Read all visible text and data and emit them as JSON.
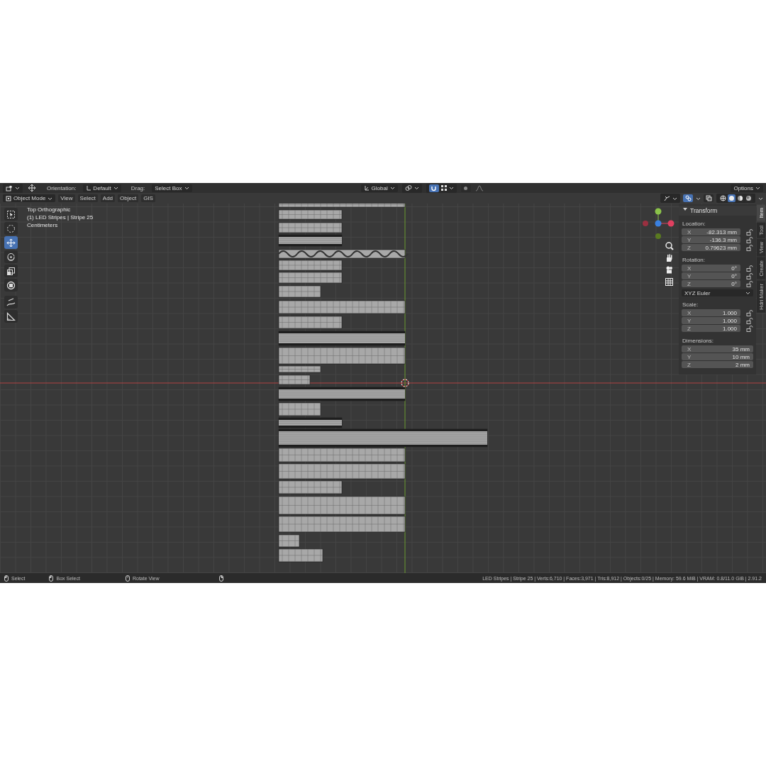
{
  "header": {
    "orientation_label": "Orientation:",
    "orientation": "Default",
    "drag_label": "Drag:",
    "drag": "Select Box",
    "transform_orientation": "Global",
    "snap_on": true,
    "proportional_on": false,
    "options": "Options"
  },
  "menu": {
    "mode": "Object Mode",
    "items": [
      "View",
      "Select",
      "Add",
      "Object",
      "GIS"
    ]
  },
  "view_shading": {
    "overlays_on": true,
    "xray_on": false,
    "modes": [
      {
        "kind": "wireframe",
        "selected": false
      },
      {
        "kind": "solid",
        "selected": true
      },
      {
        "kind": "material",
        "selected": false
      },
      {
        "kind": "rendered",
        "selected": false
      }
    ]
  },
  "viewport": {
    "info": [
      "Top Orthographic",
      "(1) LED Stripes | Stripe 25",
      "Centimeters"
    ]
  },
  "tools": [
    {
      "kind": "select",
      "selected": false
    },
    {
      "kind": "cursor",
      "selected": false
    },
    {
      "kind": "move",
      "selected": true
    },
    {
      "kind": "rotate",
      "selected": false
    },
    {
      "kind": "scale",
      "selected": false
    },
    {
      "kind": "transform",
      "selected": false
    },
    {
      "kind": "annotate",
      "selected": false
    },
    {
      "kind": "measure",
      "selected": false
    }
  ],
  "sidebar": {
    "tabs": [
      {
        "label": "Item",
        "selected": true
      },
      {
        "label": "Tool",
        "selected": false
      },
      {
        "label": "View",
        "selected": false
      },
      {
        "label": "Create",
        "selected": false
      },
      {
        "label": "Hdri Maker",
        "selected": false
      }
    ],
    "panel_title": "Transform",
    "groups": [
      {
        "label": "Location:",
        "locks": true,
        "rows": [
          {
            "axis": "X",
            "value": "-82.313 mm"
          },
          {
            "axis": "Y",
            "value": "-136.3 mm"
          },
          {
            "axis": "Z",
            "value": "0.79623 mm"
          }
        ]
      },
      {
        "label": "Rotation:",
        "locks": true,
        "rows": [
          {
            "axis": "X",
            "value": "0°"
          },
          {
            "axis": "Y",
            "value": "0°"
          },
          {
            "axis": "Z",
            "value": "0°"
          }
        ],
        "mode": "XYZ Euler"
      },
      {
        "label": "Scale:",
        "locks": true,
        "rows": [
          {
            "axis": "X",
            "value": "1.000"
          },
          {
            "axis": "Y",
            "value": "1.000"
          },
          {
            "axis": "Z",
            "value": "1.000"
          }
        ]
      },
      {
        "label": "Dimensions:",
        "locks": false,
        "rows": [
          {
            "axis": "X",
            "value": "35 mm"
          },
          {
            "axis": "Y",
            "value": "10 mm"
          },
          {
            "axis": "Z",
            "value": "2 mm"
          }
        ]
      }
    ]
  },
  "status_bar": {
    "hints": [
      {
        "kind": "left",
        "text": "Select"
      },
      {
        "kind": "drag",
        "text": "Box Select"
      },
      {
        "kind": "middle",
        "text": "Rotate View"
      },
      {
        "kind": "right"
      }
    ],
    "stats": "LED Stripes | Stripe 25 | Verts:6,710 | Faces:3,971 | Tris:8,912 | Objects:0/25 | Memory: 59.6 MiB | VRAM: 0.8/11.0 GiB | 2.91.2"
  }
}
